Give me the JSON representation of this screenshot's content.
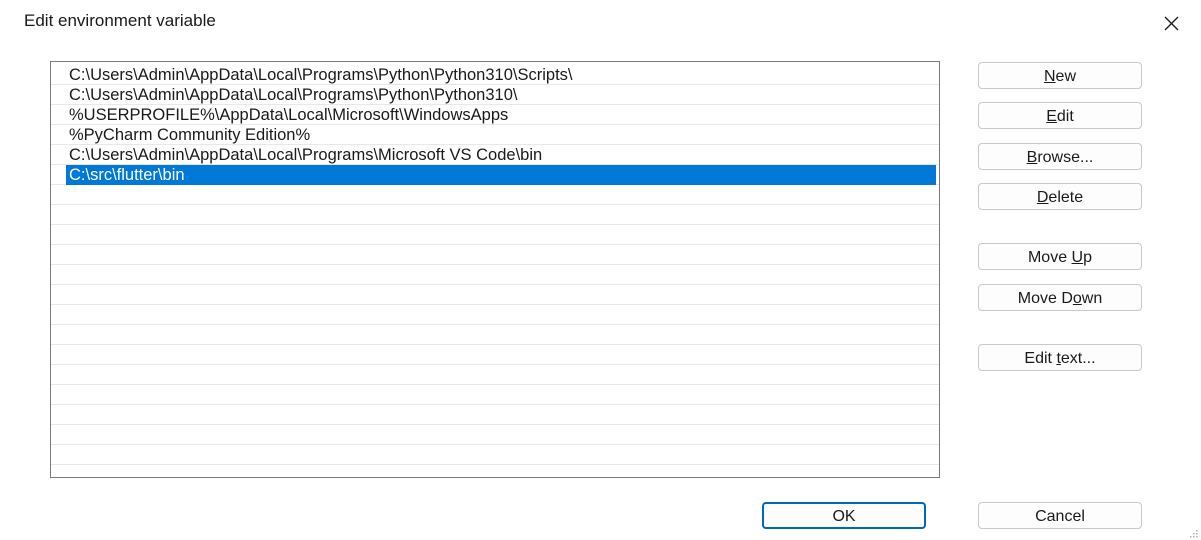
{
  "window": {
    "title": "Edit environment variable",
    "close_icon": "close-icon"
  },
  "list": {
    "items": [
      "C:\\Users\\Admin\\AppData\\Local\\Programs\\Python\\Python310\\Scripts\\",
      "C:\\Users\\Admin\\AppData\\Local\\Programs\\Python\\Python310\\",
      "%USERPROFILE%\\AppData\\Local\\Microsoft\\WindowsApps",
      "%PyCharm Community Edition%",
      "C:\\Users\\Admin\\AppData\\Local\\Programs\\Microsoft VS Code\\bin",
      "C:\\src\\flutter\\bin"
    ],
    "selected_index": 5
  },
  "buttons": {
    "new": {
      "pre": "",
      "key": "N",
      "post": "ew"
    },
    "edit": {
      "pre": "",
      "key": "E",
      "post": "dit"
    },
    "browse": {
      "pre": "",
      "key": "B",
      "post": "rowse..."
    },
    "delete": {
      "pre": "",
      "key": "D",
      "post": "elete"
    },
    "move_up": {
      "pre": "Move ",
      "key": "U",
      "post": "p"
    },
    "move_down": {
      "pre": "Move D",
      "key": "o",
      "post": "wn"
    },
    "edit_text": {
      "pre": "Edit ",
      "key": "t",
      "post": "ext..."
    },
    "ok": "OK",
    "cancel": "Cancel"
  },
  "colors": {
    "selection": "#0078d7",
    "ok_border": "#0067c0"
  }
}
